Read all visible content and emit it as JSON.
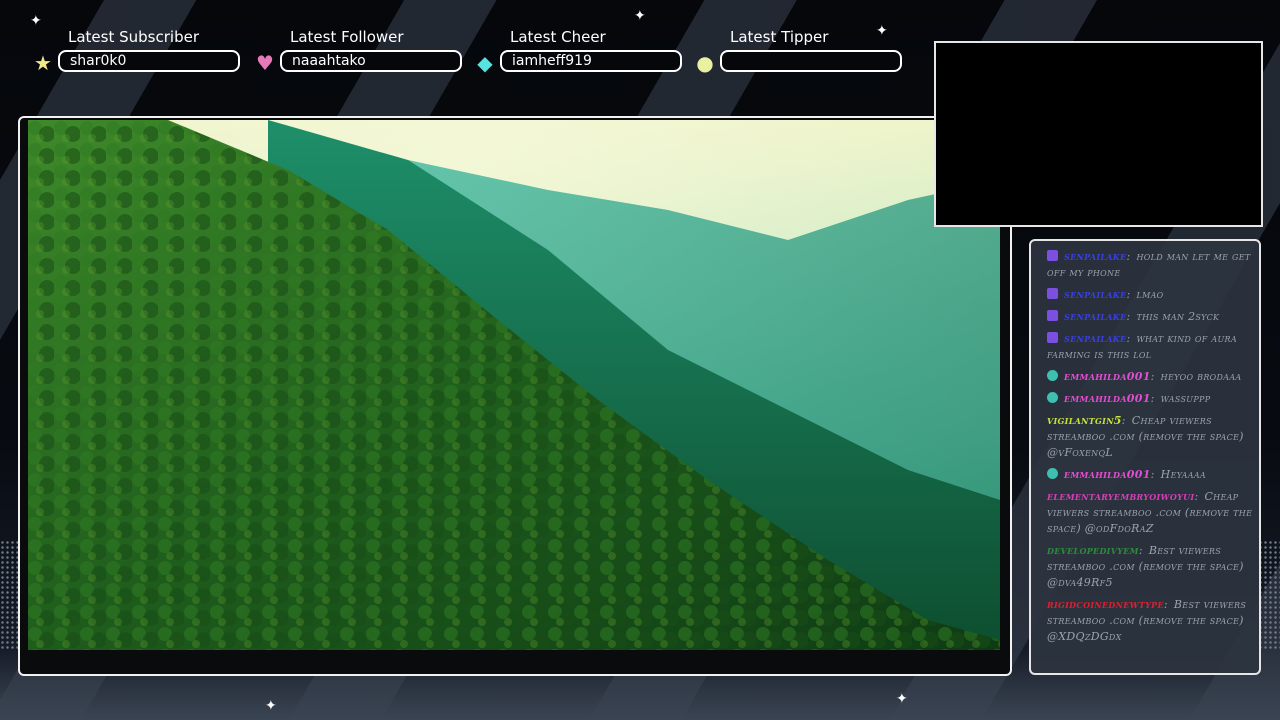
{
  "widgets": [
    {
      "label": "Latest Subscriber",
      "value": "shar0k0",
      "icon": "star-icon",
      "glyph": "★",
      "color": "#f2e98a"
    },
    {
      "label": "Latest Follower",
      "value": "naaahtako",
      "icon": "heart-icon",
      "glyph": "♥",
      "color": "#e879b8"
    },
    {
      "label": "Latest Cheer",
      "value": "iamheff919",
      "icon": "gem-icon",
      "glyph": "◆",
      "color": "#57e3e0"
    },
    {
      "label": "Latest Tipper",
      "value": "",
      "icon": "coin-icon",
      "glyph": "●",
      "color": "#e9f0a0"
    }
  ],
  "chat": {
    "messages": [
      {
        "user": "senpailake",
        "text": "hold man let me get off my phone",
        "user_color": "#3a3fe0",
        "badge": "twitch-badge"
      },
      {
        "user": "senpailake",
        "text": "lmao",
        "user_color": "#3a3fe0",
        "badge": "twitch-badge"
      },
      {
        "user": "senpailake",
        "text": "this man 2syck",
        "user_color": "#3a3fe0",
        "badge": "twitch-badge"
      },
      {
        "user": "senpailake",
        "text": "what kind of aura farming is this lol",
        "user_color": "#3a3fe0",
        "badge": "twitch-badge"
      },
      {
        "user": "emmahilda001",
        "text": "heyoo brodaaa",
        "user_color": "#e04fd0",
        "badge": "gem-badge"
      },
      {
        "user": "emmahilda001",
        "text": "wassuppp",
        "user_color": "#e04fd0",
        "badge": "gem-badge"
      },
      {
        "user": "vigilantgin5",
        "text": "Cheap viewers streamboo .com (remove the space) @vFoxenqL",
        "user_color": "#c9e23a",
        "badge": ""
      },
      {
        "user": "emmahilda001",
        "text": "Heyaaaa",
        "user_color": "#e04fd0",
        "badge": "gem-badge"
      },
      {
        "user": "elementaryembryoiwoyui",
        "text": "Cheap viewers streamboo .com (remove the space) @odFdoRaZ",
        "user_color": "#d63fb8",
        "badge": ""
      },
      {
        "user": "developedivyem",
        "text": "Best viewers streamboo .com (remove the space) @dva49Rf5",
        "user_color": "#2e8b3e",
        "badge": ""
      },
      {
        "user": "rigidcoinednewtype",
        "text": "Best viewers streamboo .com (remove the space) @XDQzDGdx",
        "user_color": "#e01f2f",
        "badge": ""
      }
    ]
  }
}
